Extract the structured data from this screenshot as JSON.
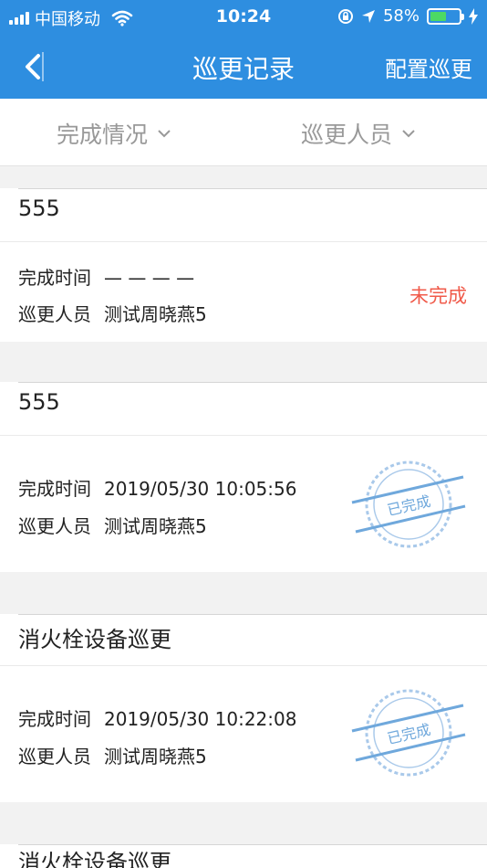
{
  "status_bar": {
    "carrier": "中国移动",
    "time": "10:24",
    "battery": "58%"
  },
  "nav": {
    "title": "巡更记录",
    "right_action": "配置巡更"
  },
  "filters": [
    {
      "label": "完成情况"
    },
    {
      "label": "巡更人员"
    }
  ],
  "labels": {
    "completion_time": "完成时间",
    "patrol_person": "巡更人员"
  },
  "records": [
    {
      "title": "555",
      "completion_time": "— — — —",
      "person": "测试周晓燕5",
      "status": "未完成"
    },
    {
      "title": "555",
      "completion_time": "2019/05/30 10:05:56",
      "person": "测试周晓燕5",
      "status": "已完成"
    },
    {
      "title": "消火栓设备巡更",
      "completion_time": "2019/05/30 10:22:08",
      "person": "测试周晓燕5",
      "status": "已完成"
    },
    {
      "title": "消火栓设备巡更"
    }
  ],
  "colors": {
    "header": "#2e8ee0",
    "pending": "#f05a4a",
    "stamp": "#6fa8dc"
  }
}
